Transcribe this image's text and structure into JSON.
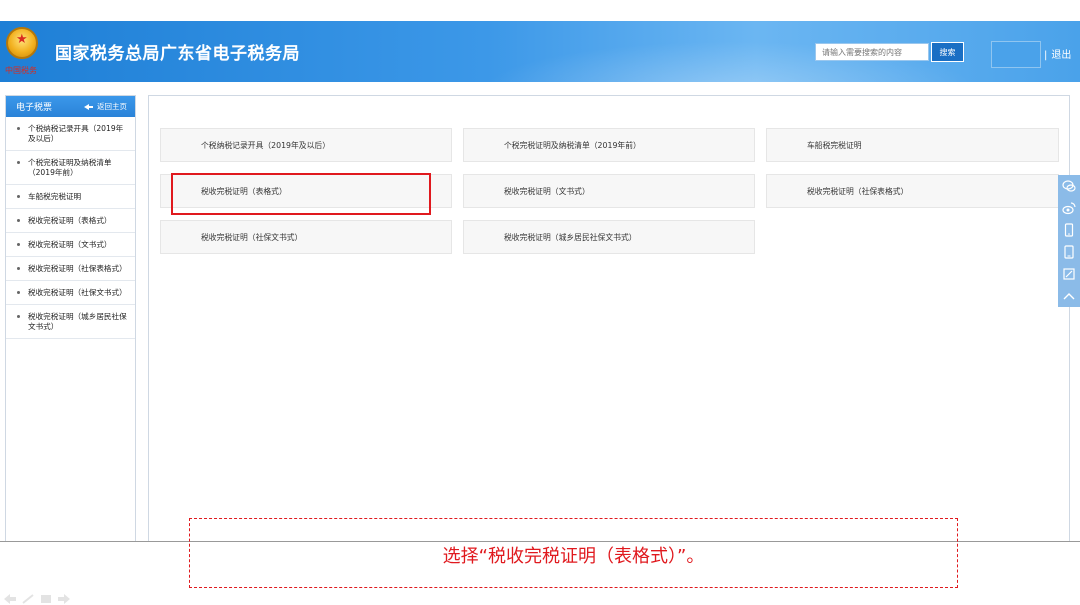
{
  "header": {
    "emblem_sub": "中国税务",
    "site_title": "国家税务总局广东省电子税务局",
    "search_placeholder": "请输入需要搜索的内容",
    "search_button": "搜索",
    "logout": "退出",
    "separator": "|",
    "brand_colors": {
      "header": "#2a86da",
      "accent_red": "#e0191e"
    }
  },
  "sidebar": {
    "title": "电子税票",
    "back_label": "返回主页",
    "items": [
      {
        "label": "个税纳税记录开具（2019年及以后）"
      },
      {
        "label": "个税完税证明及纳税清单（2019年前）"
      },
      {
        "label": "车船税完税证明"
      },
      {
        "label": "税收完税证明（表格式）"
      },
      {
        "label": "税收完税证明（文书式）"
      },
      {
        "label": "税收完税证明（社保表格式）"
      },
      {
        "label": "税收完税证明（社保文书式）"
      },
      {
        "label": "税收完税证明（城乡居民社保文书式）"
      }
    ]
  },
  "cards": [
    {
      "label": "个税纳税记录开具（2019年及以后）"
    },
    {
      "label": "个税完税证明及纳税清单（2019年前）"
    },
    {
      "label": "车船税完税证明"
    },
    {
      "label": "税收完税证明（表格式）"
    },
    {
      "label": "税收完税证明（文书式）"
    },
    {
      "label": "税收完税证明（社保表格式）"
    },
    {
      "label": "税收完税证明（社保文书式）"
    },
    {
      "label": "税收完税证明（城乡居民社保文书式）"
    }
  ],
  "tools": [
    "chat-icon",
    "weibo-icon",
    "mobile-icon",
    "tablet-icon",
    "edit-icon",
    "back-to-top-icon"
  ],
  "caption": "选择“税收完税证明（表格式）”。"
}
